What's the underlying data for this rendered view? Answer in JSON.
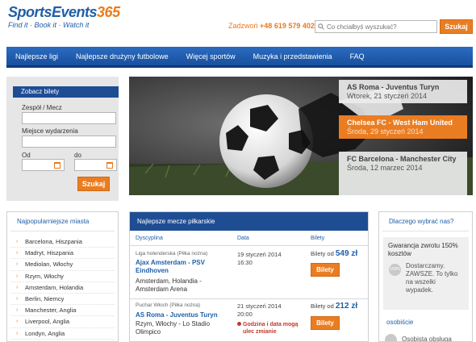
{
  "header": {
    "logo_text_1": "SportsEvents",
    "logo_text_2": "365",
    "tagline": "Find it · Book it · Watch it",
    "phone_label": "Zadzwoń",
    "phone_number": "+48 619 579 402",
    "search_placeholder": "Co chciałbyś wyszukać?",
    "search_button": "Szukaj"
  },
  "nav": {
    "items": [
      {
        "label": "Najlepsze ligi"
      },
      {
        "label": "Najlepsze drużyny futbolowe"
      },
      {
        "label": "Więcej sportów"
      },
      {
        "label": "Muzyka i przedstawienia"
      },
      {
        "label": "FAQ"
      }
    ]
  },
  "ticket_form": {
    "title": "Zobacz bilety",
    "team_label": "Zespół / Mecz",
    "venue_label": "Miejsce wydarzenia",
    "from_label": "Od",
    "to_label": "do",
    "submit": "Szukaj"
  },
  "hero": {
    "events": [
      {
        "title": "AS Roma - Juventus Turyn",
        "date": "Wtorek, 21 styczeń 2014",
        "active": false
      },
      {
        "title": "Chelsea FC - West Ham United",
        "date": "Środa, 29 styczeń 2014",
        "active": true
      },
      {
        "title": "FC Barcelona - Manchester City",
        "date": "Środa, 12 marzec 2014",
        "active": false
      }
    ]
  },
  "cities": {
    "title": "Najpopularniejsze miasta",
    "items": [
      "Barcelona, Hiszpania",
      "Madryt, Hiszpania",
      "Mediolan, Włochy",
      "Rzym, Włochy",
      "Amsterdam, Holandia",
      "Berlin, Niemcy",
      "Manchester, Anglia",
      "Liverpool, Anglia",
      "Londyn, Anglia"
    ]
  },
  "matches": {
    "title": "Najlepsze mecze piłkarskie",
    "col_discipline": "Dyscyplina",
    "col_date": "Data",
    "col_tickets": "Bilety",
    "rows": [
      {
        "category": "Liga holenderska (Piłka nożna)",
        "name_line1": "Ajax Amsterdam - PSV",
        "name_line2": "Eindhoven",
        "venue_line1": "Amsterdam, Holandia -",
        "venue_line2": "Amsterdam Arena",
        "date": "19 styczeń 2014",
        "time": "16:30",
        "price_prefix": "Bilety od",
        "price": "549 zł",
        "button": "Bilety",
        "warning_line1": "",
        "warning_line2": ""
      },
      {
        "category": "Puchar Włoch (Piłka nożna)",
        "name_line1": "AS Roma - Juventus Turyn",
        "name_line2": "",
        "venue_line1": "Rzym, Włochy - Lo Stadio",
        "venue_line2": "Olimpico",
        "date": "21 styczeń 2014",
        "time": "20:00",
        "price_prefix": "Bilety od",
        "price": "212 zł",
        "button": "Bilety",
        "warning_line1": "Godzina i data mogą",
        "warning_line2": "ulec zmianie"
      }
    ]
  },
  "why": {
    "title": "Dlaczego wybrać nas?",
    "guarantee_line1": "Gwarancja zwrotu 150%",
    "guarantee_line2": "kosztów",
    "icon_text": "150%",
    "deliver_line1": "Dostarczamy.",
    "deliver_line2": "ZAWSZE. To tylko",
    "deliver_line3": "na wszelki",
    "deliver_line4": "wypadek.",
    "subtitle": "osobiście",
    "service": "Osobista obsługa"
  }
}
